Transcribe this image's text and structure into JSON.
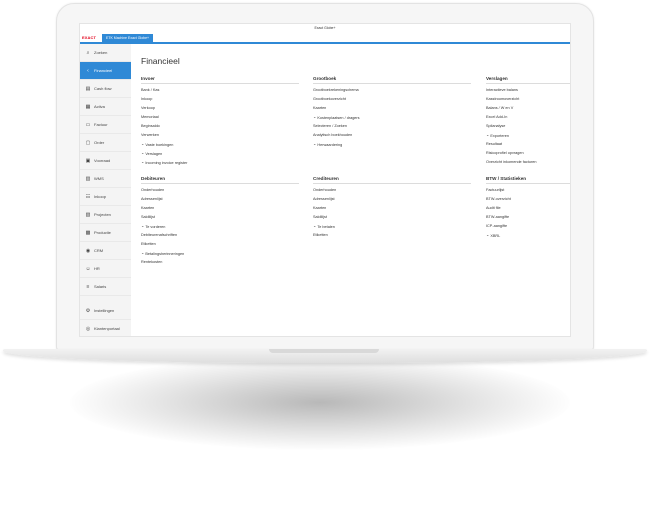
{
  "window": {
    "title": "Exact Globe+"
  },
  "header": {
    "logo": "EXACT",
    "tab": "ETK  Machine Exact Globe+"
  },
  "sidebar": {
    "items": [
      {
        "label": "Zoeken",
        "icon": "search-icon"
      },
      {
        "label": "Financieel",
        "icon": "chevron-left-icon",
        "active": true
      },
      {
        "label": "Cash flow",
        "icon": "cash-icon"
      },
      {
        "label": "Activa",
        "icon": "asset-icon"
      },
      {
        "label": "Factuur",
        "icon": "invoice-icon"
      },
      {
        "label": "Order",
        "icon": "order-icon"
      },
      {
        "label": "Voorraad",
        "icon": "stock-icon"
      },
      {
        "label": "WMS",
        "icon": "warehouse-icon"
      },
      {
        "label": "Inkoop",
        "icon": "cart-icon"
      },
      {
        "label": "Projecten",
        "icon": "project-icon"
      },
      {
        "label": "Productie",
        "icon": "factory-icon"
      },
      {
        "label": "CRM",
        "icon": "crm-icon"
      },
      {
        "label": "HR",
        "icon": "hr-icon"
      },
      {
        "label": "Salaris",
        "icon": "salary-icon"
      }
    ],
    "bottom": [
      {
        "label": "Instellingen",
        "icon": "gear-icon"
      },
      {
        "label": "Klantenportaal",
        "icon": "portal-icon"
      }
    ]
  },
  "main": {
    "title": "Financieel",
    "sections": [
      {
        "title": "Invoer",
        "links": [
          {
            "label": "Bank / Kas"
          },
          {
            "label": "Inkoop"
          },
          {
            "label": "Verkoop"
          },
          {
            "label": "Memoriaal"
          },
          {
            "label": "Beginsaldo"
          },
          {
            "label": "Verwerken"
          },
          {
            "label": "Vaste boekingen",
            "collapse": true
          },
          {
            "label": "Verslagen",
            "collapse": true
          },
          {
            "label": "Incoming invoice register",
            "collapse": true
          }
        ]
      },
      {
        "title": "Grootboek",
        "links": [
          {
            "label": "Grootboekrekeningschema"
          },
          {
            "label": "Grootboekoverzicht"
          },
          {
            "label": "Kaarten"
          },
          {
            "label": "Kostenplaatsen / dragers",
            "collapse": true
          },
          {
            "label": "Selecteren / Zoeken"
          },
          {
            "label": "Analytisch boekhouden"
          },
          {
            "label": "Herwaardering",
            "collapse": true
          }
        ]
      },
      {
        "title": "Verslagen",
        "links": [
          {
            "label": "Interactieve balans"
          },
          {
            "label": "Kasstroomoverzicht"
          },
          {
            "label": "Balans / W en V"
          },
          {
            "label": "Excel Add-In"
          },
          {
            "label": "Spilanalyse"
          },
          {
            "label": "Exporteren",
            "collapse": true
          },
          {
            "label": "Resultaat"
          },
          {
            "label": "Risicoprofiel opvragen"
          },
          {
            "label": "Overzicht inkomende facturen"
          }
        ]
      },
      {
        "title": "Debiteuren",
        "links": [
          {
            "label": "Onderhouden"
          },
          {
            "label": "Adressenlijst"
          },
          {
            "label": "Kaarten"
          },
          {
            "label": "Saldilijst"
          },
          {
            "label": "Te vorderen",
            "collapse": true
          },
          {
            "label": "Debiteurenafschriften"
          },
          {
            "label": "Etiketten"
          },
          {
            "label": "Betalingsherinneringen",
            "collapse": true
          },
          {
            "label": "Rentekosten"
          }
        ]
      },
      {
        "title": "Crediteuren",
        "links": [
          {
            "label": "Onderhouden"
          },
          {
            "label": "Adressenlijst"
          },
          {
            "label": "Kaarten"
          },
          {
            "label": "Saldilijst"
          },
          {
            "label": "Te betalen",
            "collapse": true
          },
          {
            "label": "Etiketten"
          }
        ]
      },
      {
        "title": "BTW / Statistieken",
        "links": [
          {
            "label": "Factuurlijst"
          },
          {
            "label": "BTW-overzicht"
          },
          {
            "label": "Audit file"
          },
          {
            "label": "BTW-aangifte"
          },
          {
            "label": "ICP-aangifte"
          },
          {
            "label": "XBRL",
            "collapse": true
          }
        ]
      }
    ]
  }
}
